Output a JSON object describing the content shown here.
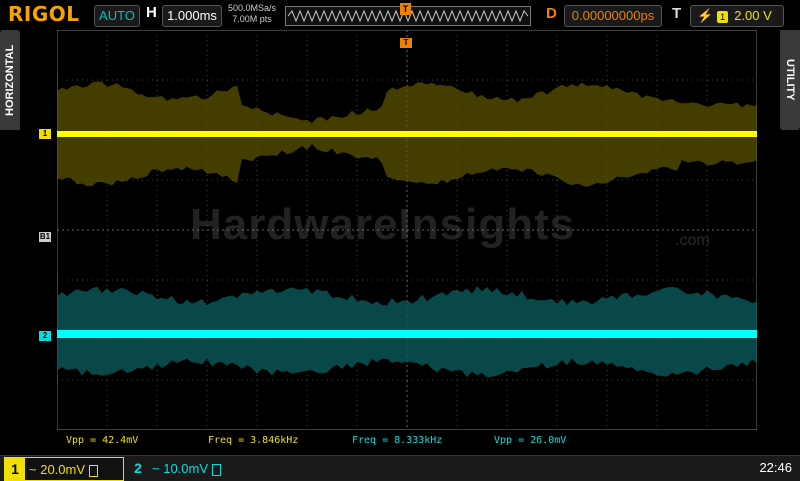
{
  "brand": "RIGOL",
  "top": {
    "mode": "AUTO",
    "h_label": "H",
    "timebase": "1.000ms",
    "sample_rate": "500.0MSa/s",
    "mem_depth": "7.00M pts",
    "d_label": "D",
    "delay": "0.00000000ps",
    "t_label": "T",
    "trigger_level": "2.00 V",
    "trigger_source": "1",
    "trig_marker": "T"
  },
  "side": {
    "left": "HORIZONTAL",
    "right": "UTILITY"
  },
  "markers": {
    "ch1": "1",
    "ch2": "2",
    "math": "B1"
  },
  "watermark": {
    "main": "HardwareInsights",
    "sub": ".com"
  },
  "measurements": [
    {
      "text": "Vpp  =  42.4mV",
      "color": "#f0e000"
    },
    {
      "text": "Freq  =  3.846kHz",
      "color": "#f0e000"
    },
    {
      "text": "Freq  =  8.333kHz",
      "color": "#00e0e0"
    },
    {
      "text": "Vpp  =  26.0mV",
      "color": "#00e0e0"
    }
  ],
  "bottom": {
    "ch1": {
      "num": "1",
      "coupling": "~",
      "scale": "20.0mV"
    },
    "ch2": {
      "num": "2",
      "coupling": "~",
      "scale": "10.0mV"
    },
    "time": "22:46"
  },
  "colors": {
    "ch1": "#f0e000",
    "ch2": "#00e0e0",
    "accent": "#f08000"
  }
}
